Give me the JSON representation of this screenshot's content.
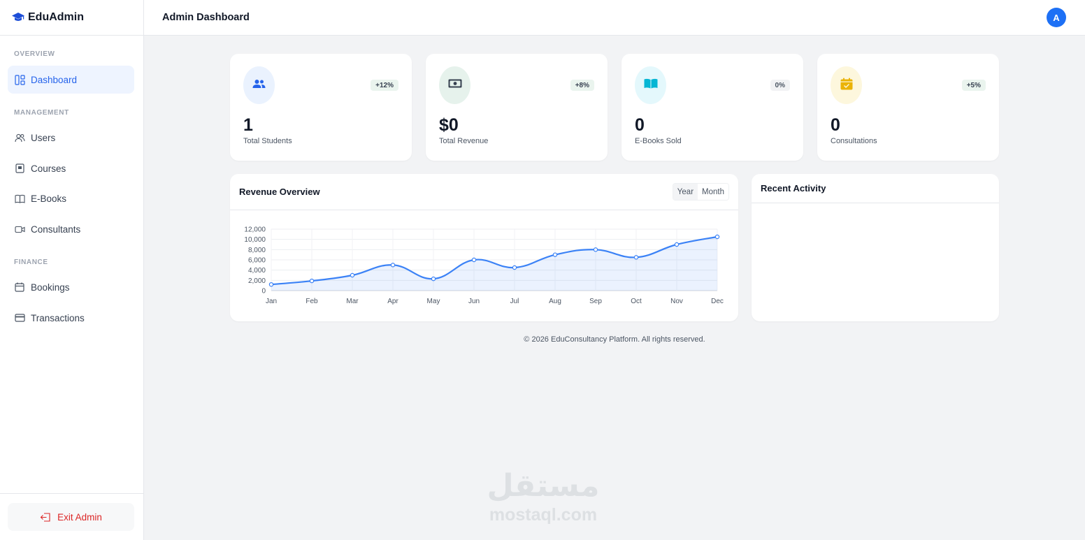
{
  "app": {
    "name": "EduAdmin"
  },
  "header": {
    "title": "Admin Dashboard",
    "avatar_initial": "A"
  },
  "sidebar": {
    "sections": {
      "overview": "OVERVIEW",
      "management": "MANAGEMENT",
      "finance": "FINANCE"
    },
    "items": [
      {
        "label": "Dashboard",
        "icon": "dashboard-icon",
        "active": true
      },
      {
        "label": "Users",
        "icon": "users-icon"
      },
      {
        "label": "Courses",
        "icon": "courses-icon"
      },
      {
        "label": "E-Books",
        "icon": "book-icon"
      },
      {
        "label": "Consultants",
        "icon": "video-icon"
      },
      {
        "label": "Bookings",
        "icon": "calendar-icon"
      },
      {
        "label": "Transactions",
        "icon": "credit-card-icon"
      }
    ],
    "exit_label": "Exit Admin"
  },
  "stats": [
    {
      "value": "1",
      "label": "Total Students",
      "badge": "+12%",
      "icon": "users-icon",
      "icon_color": "#2563eb",
      "icon_bg": "#eaf2fe"
    },
    {
      "value": "$0",
      "label": "Total Revenue",
      "badge": "+8%",
      "icon": "money-icon",
      "icon_color": "#374151",
      "icon_bg": "#e6f2ec"
    },
    {
      "value": "0",
      "label": "E-Books Sold",
      "badge": "0%",
      "icon": "book-open-icon",
      "icon_color": "#06b6d4",
      "icon_bg": "#e4f8fc"
    },
    {
      "value": "0",
      "label": "Consultations",
      "badge": "+5%",
      "icon": "calendar-check-icon",
      "icon_color": "#eab308",
      "icon_bg": "#fdf7dd"
    }
  ],
  "revenue": {
    "title": "Revenue Overview",
    "toggle": {
      "year": "Year",
      "month": "Month"
    }
  },
  "activity": {
    "title": "Recent Activity"
  },
  "footer": "© 2026 EduConsultancy Platform. All rights reserved.",
  "watermark": {
    "arabic": "مستقل",
    "latin": "mostaql.com"
  },
  "chart_data": {
    "type": "line",
    "categories": [
      "Jan",
      "Feb",
      "Mar",
      "Apr",
      "May",
      "Jun",
      "Jul",
      "Aug",
      "Sep",
      "Oct",
      "Nov",
      "Dec"
    ],
    "series": [
      {
        "values": [
          1200,
          1900,
          3000,
          5000,
          2300,
          6000,
          4500,
          7000,
          8000,
          6500,
          9000,
          10500
        ]
      }
    ],
    "ylim": [
      0,
      12000
    ],
    "yticks": [
      0,
      2000,
      4000,
      6000,
      8000,
      10000,
      12000
    ],
    "color": "#3b82f6",
    "fill": "area",
    "grid": true,
    "title": "",
    "xlabel": "",
    "ylabel": ""
  }
}
